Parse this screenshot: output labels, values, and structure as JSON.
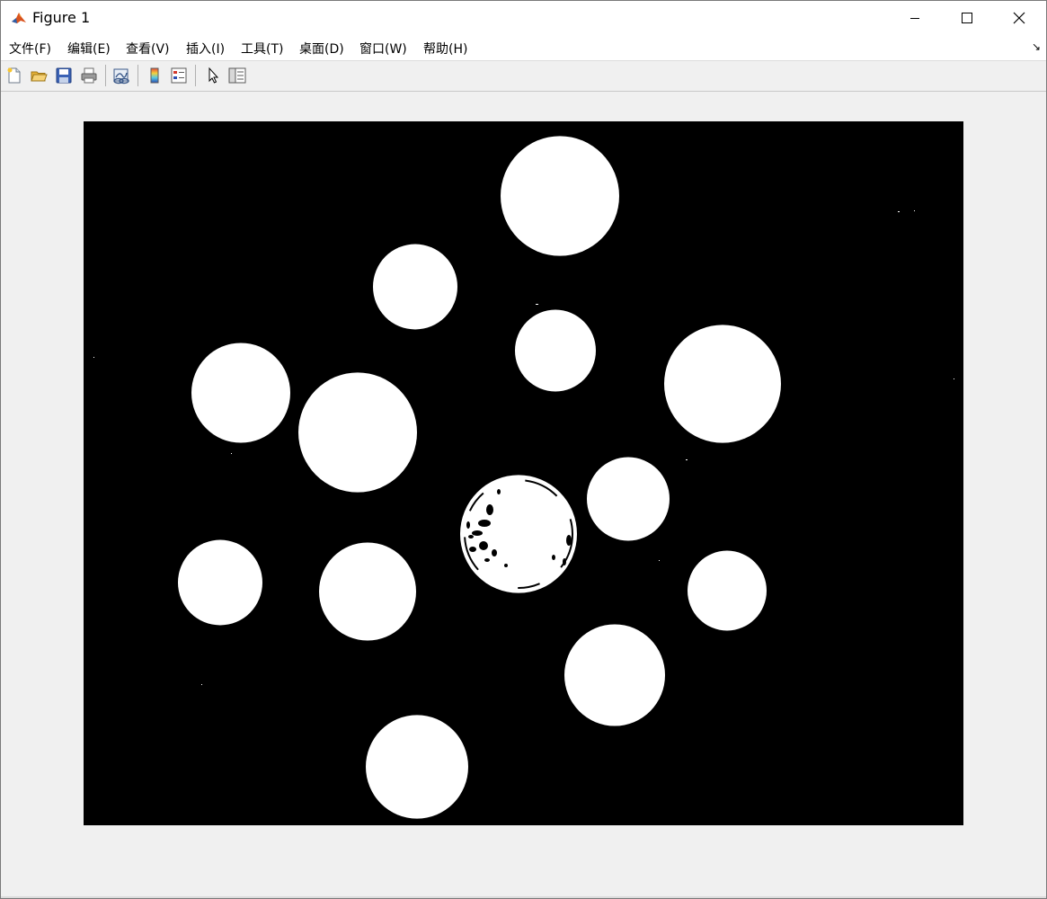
{
  "window": {
    "title": "Figure 1",
    "controls": [
      "minimize",
      "maximize",
      "close"
    ]
  },
  "menubar": {
    "items": [
      {
        "label": "文件(F)"
      },
      {
        "label": "编辑(E)"
      },
      {
        "label": "查看(V)"
      },
      {
        "label": "插入(I)"
      },
      {
        "label": "工具(T)"
      },
      {
        "label": "桌面(D)"
      },
      {
        "label": "窗口(W)"
      },
      {
        "label": "帮助(H)"
      }
    ],
    "dock_icon": "↘"
  },
  "toolbar": {
    "buttons": [
      {
        "icon": "new-figure-icon"
      },
      {
        "icon": "open-file-icon"
      },
      {
        "icon": "save-icon"
      },
      {
        "icon": "print-icon"
      },
      {
        "icon": "link-plot-icon"
      },
      {
        "icon": "insert-colorbar-icon"
      },
      {
        "icon": "insert-legend-icon"
      },
      {
        "icon": "edit-plot-icon"
      },
      {
        "icon": "property-inspector-icon"
      }
    ]
  },
  "image": {
    "description_type": "binary mask",
    "background_color": "#000000",
    "foreground_color": "#ffffff",
    "object_count": 15
  }
}
